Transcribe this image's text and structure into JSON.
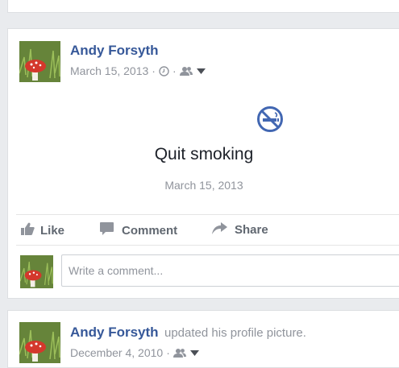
{
  "post": {
    "author": "Andy Forsyth",
    "date": "March 15, 2013",
    "separator": "·",
    "clock_icon": "clock-icon",
    "audience_icon": "friends-icon",
    "dropdown_icon": "caret-down-icon",
    "life_event": {
      "icon": "no-smoking-icon",
      "title": "Quit smoking",
      "date": "March 15, 2013"
    },
    "actions": [
      {
        "label": "Like",
        "icon": "thumbs-up-icon"
      },
      {
        "label": "Comment",
        "icon": "speech-bubble-icon"
      },
      {
        "label": "Share",
        "icon": "share-arrow-icon"
      }
    ],
    "comment_placeholder": "Write a comment..."
  },
  "profile_update": {
    "author": "Andy Forsyth",
    "action_text": "updated his profile picture.",
    "date": "December 4, 2010",
    "separator": "·"
  },
  "colors": {
    "link": "#365899",
    "muted": "#90949c",
    "icon_blue": "#4267b2",
    "page_bg": "#e9ebee"
  }
}
